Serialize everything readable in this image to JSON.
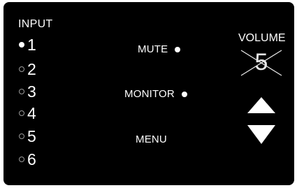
{
  "input": {
    "title": "INPUT",
    "items": [
      {
        "label": "1",
        "selected": true
      },
      {
        "label": "2",
        "selected": false
      },
      {
        "label": "3",
        "selected": false
      },
      {
        "label": "4",
        "selected": false
      },
      {
        "label": "5",
        "selected": false
      },
      {
        "label": "6",
        "selected": false
      }
    ]
  },
  "controls": {
    "mute_label": "MUTE",
    "monitor_label": "MONITOR",
    "menu_label": "MENU"
  },
  "volume": {
    "title": "VOLUME",
    "value": "5",
    "muted": true,
    "up_icon": "triangle-up-icon",
    "down_icon": "triangle-down-icon"
  },
  "colors": {
    "panel_background": "#000000",
    "text": "#ffffff"
  }
}
